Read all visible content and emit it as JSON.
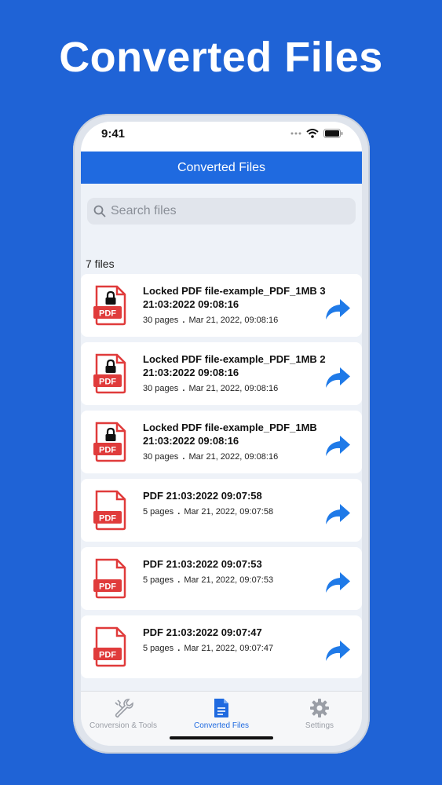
{
  "headline": "Converted Files",
  "status_bar": {
    "time": "9:41"
  },
  "navbar": {
    "title": "Converted Files"
  },
  "search": {
    "placeholder": "Search files"
  },
  "file_count": "7 files",
  "files": [
    {
      "title": "Locked PDF file-example_PDF_1MB 3 21:03:2022 09:08:16",
      "pages": "30 pages",
      "date": "Mar 21, 2022, 09:08:16",
      "locked": true
    },
    {
      "title": "Locked PDF file-example_PDF_1MB 2 21:03:2022 09:08:16",
      "pages": "30 pages",
      "date": "Mar 21, 2022, 09:08:16",
      "locked": true
    },
    {
      "title": "Locked PDF file-example_PDF_1MB 21:03:2022 09:08:16",
      "pages": "30 pages",
      "date": "Mar 21, 2022, 09:08:16",
      "locked": true
    },
    {
      "title": "PDF 21:03:2022 09:07:58",
      "pages": "5 pages",
      "date": "Mar 21, 2022, 09:07:58",
      "locked": false
    },
    {
      "title": "PDF 21:03:2022 09:07:53",
      "pages": "5 pages",
      "date": "Mar 21, 2022, 09:07:53",
      "locked": false
    },
    {
      "title": "PDF 21:03:2022 09:07:47",
      "pages": "5 pages",
      "date": "Mar 21, 2022, 09:07:47",
      "locked": false
    }
  ],
  "pdf_badge_text": "PDF",
  "meta_separator": ".",
  "tabs": [
    {
      "label": "Conversion & Tools",
      "icon": "wrench-icon",
      "active": false
    },
    {
      "label": "Converted Files",
      "icon": "document-icon",
      "active": true
    },
    {
      "label": "Settings",
      "icon": "gear-icon",
      "active": false
    }
  ],
  "colors": {
    "background": "#1f63d6",
    "navbar": "#1f6ae0",
    "pdf_red": "#e03b3b",
    "share_blue": "#1f7ae8",
    "tab_active": "#1f6ae0",
    "tab_inactive": "#9a9ea6"
  }
}
